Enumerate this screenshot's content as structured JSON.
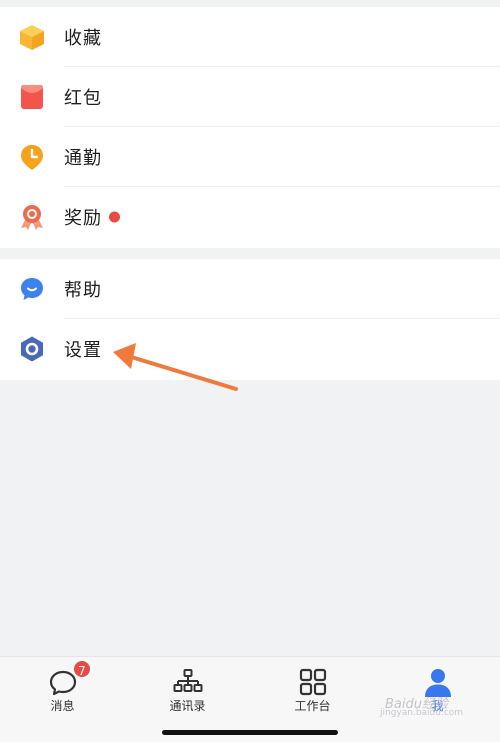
{
  "menu_group_1": [
    {
      "label": "收藏",
      "icon": "favorites-box-icon",
      "color": "#f7b733"
    },
    {
      "label": "红包",
      "icon": "red-envelope-icon",
      "color": "#f2554c"
    },
    {
      "label": "通勤",
      "icon": "commute-clock-icon",
      "color": "#f7a21b"
    },
    {
      "label": "奖励",
      "icon": "reward-medal-icon",
      "color": "#ef6a4a",
      "badge_dot": true
    }
  ],
  "menu_group_2": [
    {
      "label": "帮助",
      "icon": "help-chat-icon",
      "color": "#3b82f0"
    },
    {
      "label": "设置",
      "icon": "settings-hexagon-icon",
      "color": "#4a68b8"
    }
  ],
  "annotation": {
    "icon": "orange-arrow-icon",
    "color": "#f07a3c"
  },
  "tabbar": {
    "tabs": [
      {
        "label": "消息",
        "icon": "message-bubble-icon",
        "badge": "7"
      },
      {
        "label": "通讯录",
        "icon": "org-chart-icon"
      },
      {
        "label": "工作台",
        "icon": "grid-apps-icon"
      },
      {
        "label": "我",
        "icon": "person-icon",
        "active": true
      }
    ]
  },
  "watermark": {
    "text": "Baidu经验",
    "sub": "jingyan.baidu.com"
  }
}
